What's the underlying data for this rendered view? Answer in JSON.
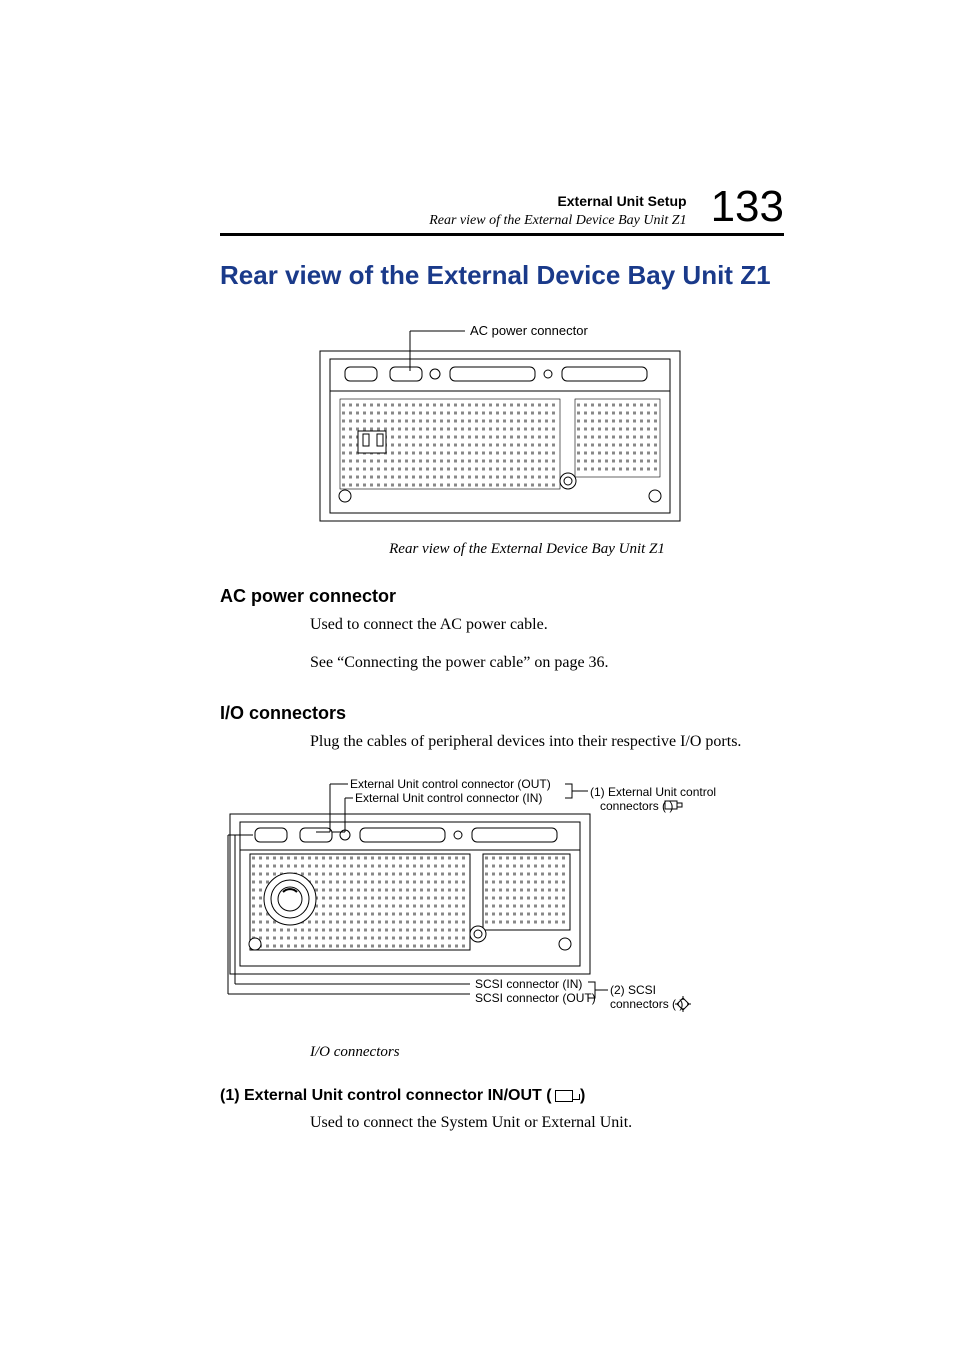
{
  "header": {
    "chapter": "External Unit Setup",
    "subtitle": "Rear view of the External Device Bay Unit Z1",
    "page_number": "133"
  },
  "title": "Rear view of the External Device Bay Unit Z1",
  "figure1": {
    "label_ac": "AC power connector",
    "caption": "Rear view of the External Device Bay Unit Z1"
  },
  "section_ac": {
    "heading": "AC power connector",
    "p1": "Used to connect the AC power cable.",
    "p2": "See “Connecting the power cable” on page 36."
  },
  "section_io": {
    "heading": "I/O connectors",
    "p1": "Plug the cables of peripheral devices into their respective I/O ports."
  },
  "figure2": {
    "label_ctrl_out": "External Unit control connector (OUT)",
    "label_ctrl_in": "External Unit control connector (IN)",
    "label_group1_a": "(1) External Unit control",
    "label_group1_b": "connectors (        )",
    "label_scsi_in": "SCSI connector (IN)",
    "label_scsi_out": "SCSI connector (OUT)",
    "label_group2_a": "(2) SCSI",
    "label_group2_b": "connectors (        )",
    "caption": "I/O connectors"
  },
  "section_ext_ctrl": {
    "heading_pre": "(1) External Unit control connector IN/OUT (",
    "heading_post": " )",
    "p1": "Used to connect the System Unit or External Unit."
  }
}
